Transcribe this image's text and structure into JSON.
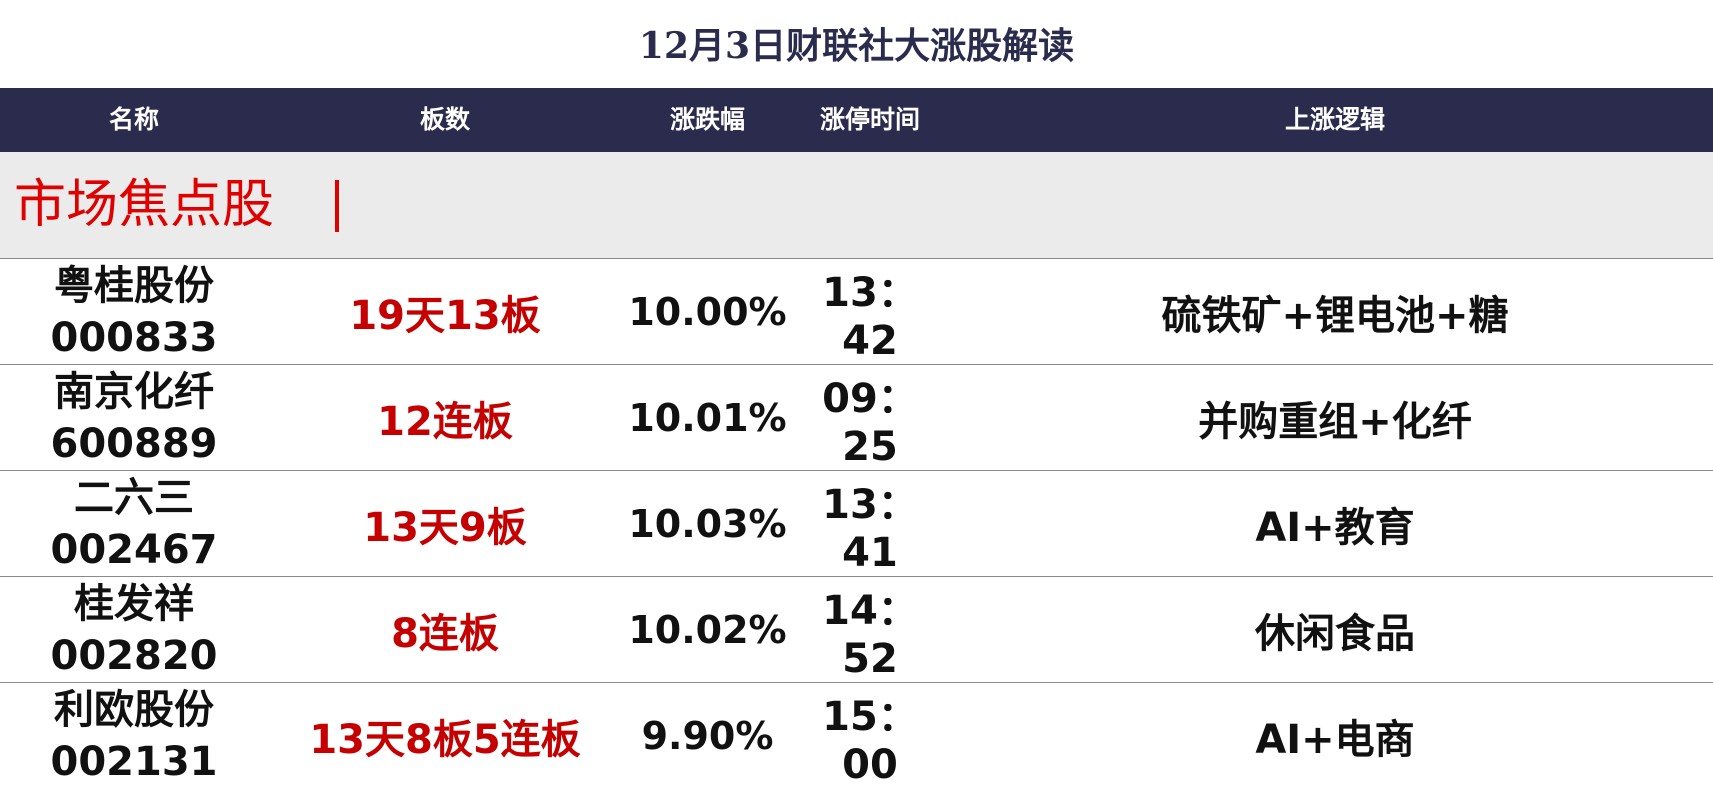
{
  "title": "12月3日财联社大涨股解读",
  "header": {
    "name": "名称",
    "boards": "板数",
    "change": "涨跌幅",
    "limit_time": "涨停时间",
    "logic": "上涨逻辑"
  },
  "section": {
    "label": "市场焦点股"
  },
  "rows": [
    {
      "name": "粤桂股份",
      "code": "000833",
      "boards": "19天13板",
      "change": "10.00%",
      "time": "13：42",
      "logic": "硫铁矿+锂电池+糖"
    },
    {
      "name": "南京化纤",
      "code": "600889",
      "boards": "12连板",
      "change": "10.01%",
      "time": "09：25",
      "logic": "并购重组+化纤"
    },
    {
      "name": "二六三",
      "code": "002467",
      "boards": "13天9板",
      "change": "10.03%",
      "time": "13：41",
      "logic": "AI+教育"
    },
    {
      "name": "桂发祥",
      "code": "002820",
      "boards": "8连板",
      "change": "10.02%",
      "time": "14：52",
      "logic": "休闲食品"
    },
    {
      "name": "利欧股份",
      "code": "002131",
      "boards": "13天8板5连板",
      "change": "9.90%",
      "time": "15：00",
      "logic": "AI+电商"
    }
  ],
  "colors": {
    "header_bg": "#2b2b4e",
    "title_text": "#2b2b4e",
    "section_bg": "#ebebeb",
    "accent_red": "#e00000",
    "board_red": "#c40000"
  }
}
